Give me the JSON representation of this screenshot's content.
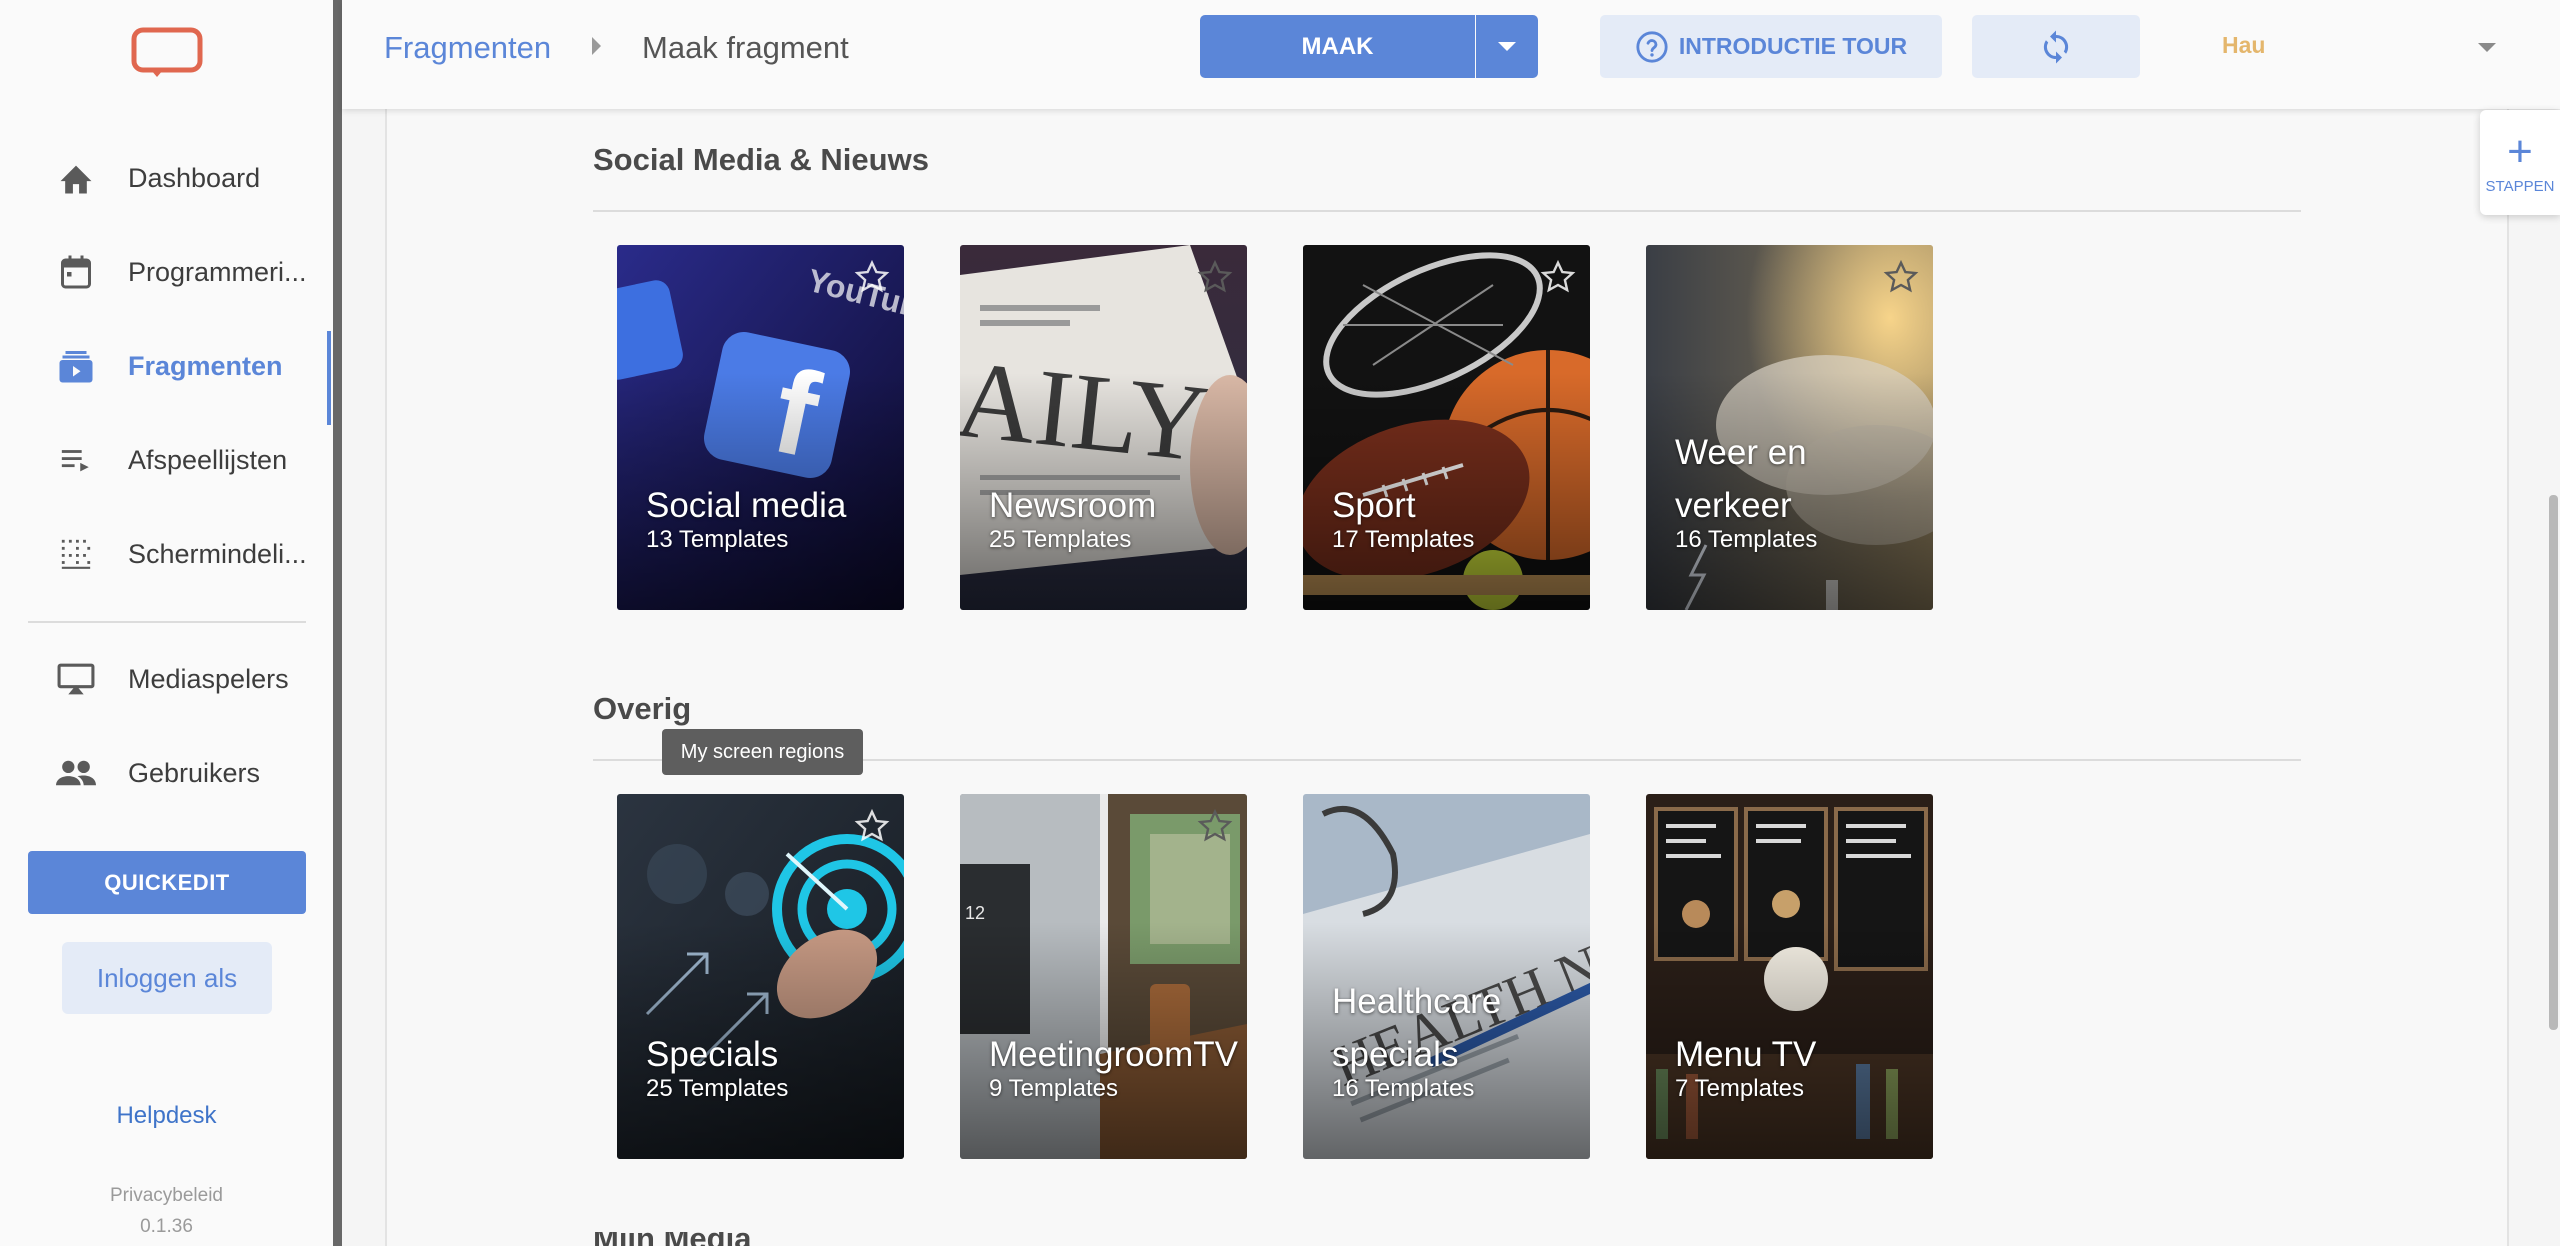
{
  "sidebar": {
    "nav": [
      {
        "label": "Dashboard",
        "icon": "home-icon"
      },
      {
        "label": "Programmeri...",
        "icon": "calendar-icon"
      },
      {
        "label": "Fragmenten",
        "icon": "fragments-icon",
        "active": true
      },
      {
        "label": "Afspeellijsten",
        "icon": "playlist-icon"
      },
      {
        "label": "Schermindeli...",
        "icon": "grid-icon"
      },
      {
        "label": "Mediaspelers",
        "icon": "monitor-icon"
      },
      {
        "label": "Gebruikers",
        "icon": "users-icon"
      }
    ],
    "quickedit_label": "QUICKEDIT",
    "login_as_label": "Inloggen als",
    "helpdesk_label": "Helpdesk",
    "privacy_label": "Privacybeleid",
    "version": "0.1.36"
  },
  "header": {
    "breadcrumb_root": "Fragmenten",
    "breadcrumb_current": "Maak fragment",
    "maak_label": "MAAK",
    "tour_label": "INTRODUCTIE TOUR",
    "user_name": "Hau"
  },
  "sections": [
    {
      "title": "Social Media & Nieuws",
      "tiles": [
        {
          "title": "Social media",
          "count": "13 Templates"
        },
        {
          "title": "Newsroom",
          "count": "25 Templates"
        },
        {
          "title": "Sport",
          "count": "17 Templates"
        },
        {
          "title": "Weer en verkeer",
          "count": "16 Templates"
        }
      ]
    },
    {
      "title": "Overig",
      "tiles": [
        {
          "title": "Specials",
          "count": "25 Templates"
        },
        {
          "title": "MeetingroomTV",
          "count": "9 Templates"
        },
        {
          "title": "Healthcare specials",
          "count": "16 Templates"
        },
        {
          "title": "Menu TV",
          "count": "7 Templates"
        }
      ]
    }
  ],
  "tooltip_text": "My screen regions",
  "next_section_peek": "Mijn Media",
  "steps_label": "STAPPEN",
  "colors": {
    "accent": "#5b86d8",
    "accent_light": "#e4ebf7",
    "user": "#e4b66c",
    "logo": "#e0674f"
  }
}
